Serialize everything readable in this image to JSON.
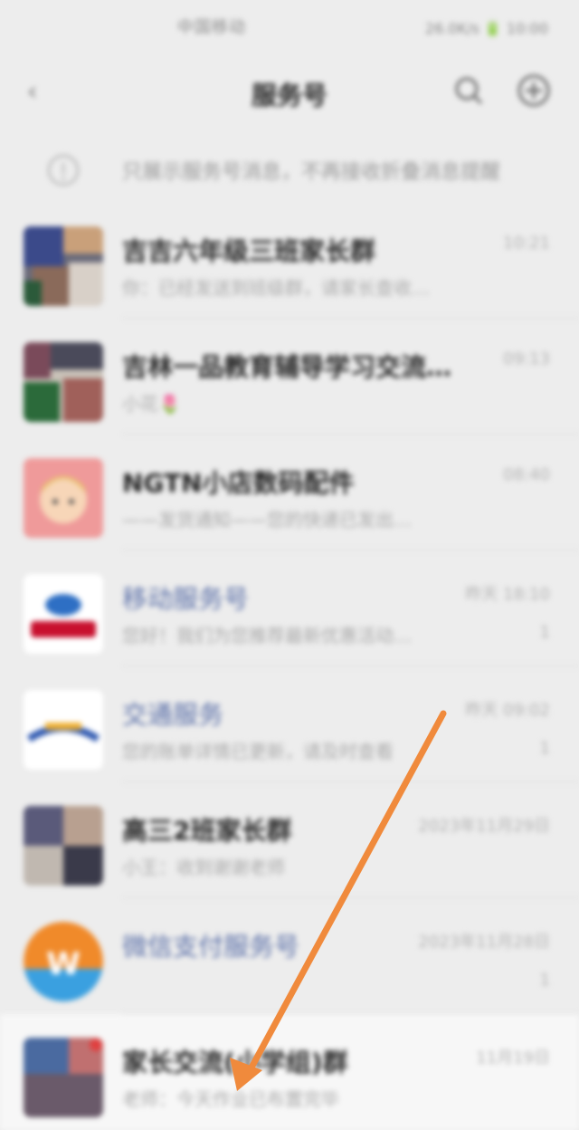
{
  "statusbar": {
    "carrier": "中国移动",
    "right": "26.0K/s 🔋 10:00"
  },
  "navbar": {
    "back": "‹",
    "title": "服务号"
  },
  "notice": {
    "text": "只展示服务号消息，不再接收折叠消息提醒"
  },
  "conversations": [
    {
      "name": "吉吉六年级三班家长群",
      "preview": "你：已经发送到班级群，请家长查收…",
      "time": "10:21",
      "unread": "",
      "avatar": "photo-collage",
      "link": false
    },
    {
      "name": "吉林一品教育辅导学习交流…",
      "preview": "小花🌷",
      "time": "09:13",
      "unread": "",
      "avatar": "photo-collage",
      "link": false
    },
    {
      "name": "NGTN小店数码配件",
      "preview": "——发货通知——您的快递已发出…",
      "time": "08:40",
      "unread": "",
      "avatar": "cartoon-pink",
      "link": false
    },
    {
      "name": "移动服务号",
      "preview": "您好！我们为您推荐最新优惠活动…",
      "time": "昨天 18:10",
      "unread": "1",
      "avatar": "blue-red-logo",
      "link": true
    },
    {
      "name": "交通服务",
      "preview": "您的账单详情已更新，请及时查看",
      "time": "昨天 09:02",
      "unread": "1",
      "avatar": "blue-logo",
      "link": true
    },
    {
      "name": "高三2班家长群",
      "preview": "小王：收到谢谢老师",
      "time": "2023年11月29日",
      "unread": "",
      "avatar": "photo-collage",
      "link": false
    },
    {
      "name": "微信支付服务号",
      "preview": "",
      "time": "2023年11月28日",
      "unread": "1",
      "avatar": "orange-w-logo",
      "link": true
    },
    {
      "name": "家长交流(小学组)群",
      "preview": "老师：今天作业已布置完毕",
      "time": "11月19日",
      "unread": "",
      "avatar": "photo-collage",
      "link": false
    }
  ],
  "colors": {
    "background": "#ededed",
    "arrow": "#f08a3c",
    "link": "#5a6fa8"
  }
}
